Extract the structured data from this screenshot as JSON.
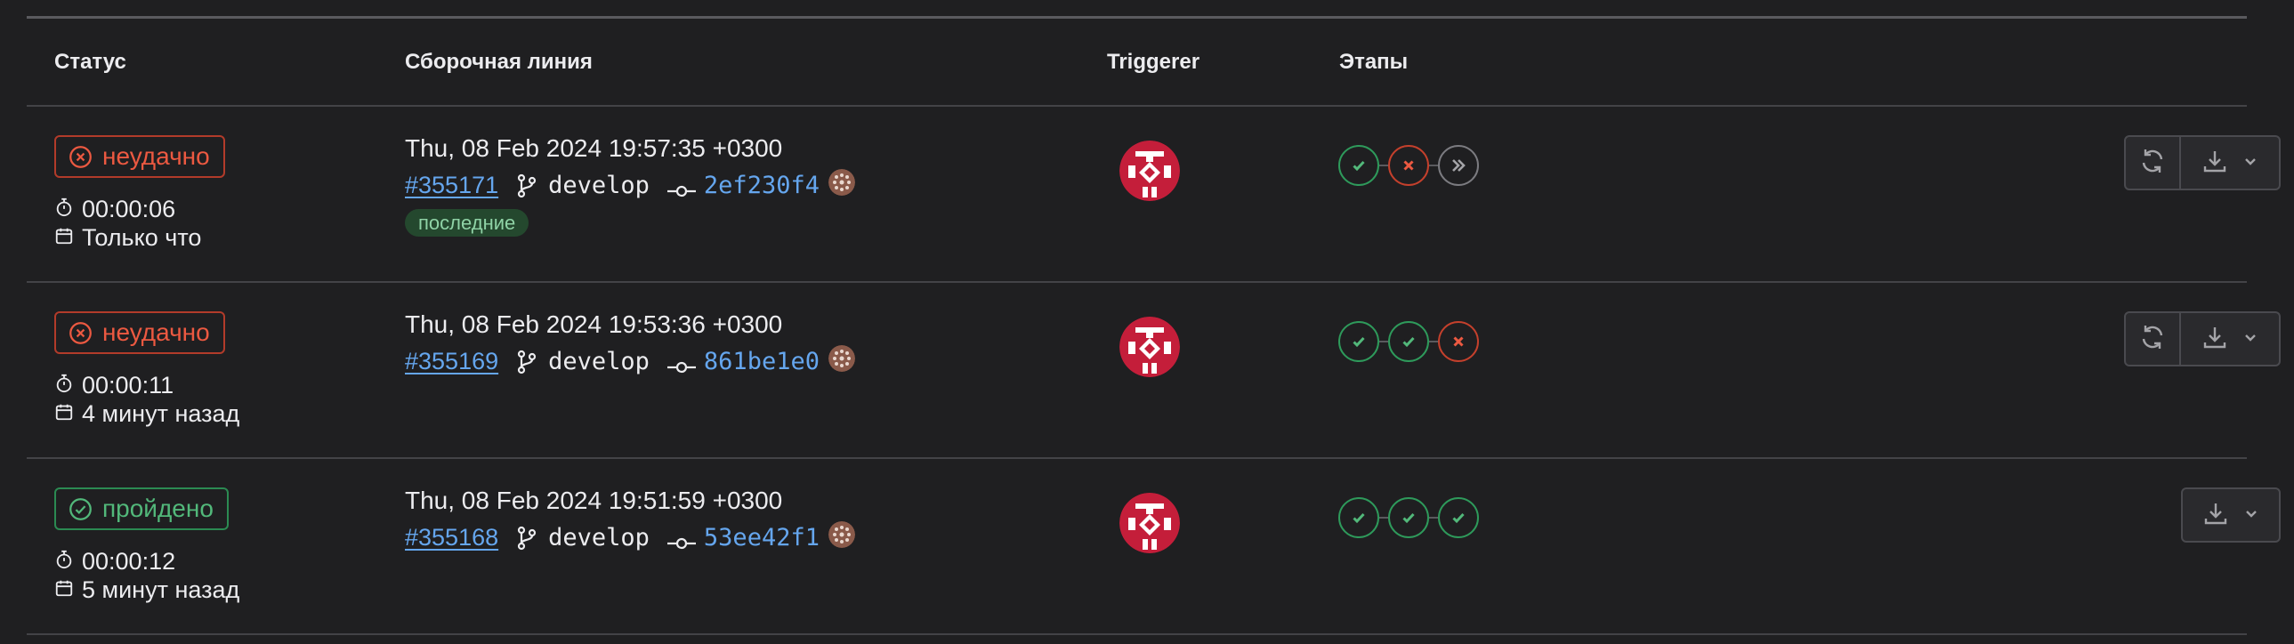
{
  "headers": {
    "status": "Статус",
    "pipeline": "Сборочная линия",
    "triggerer": "Triggerer",
    "stages": "Этапы"
  },
  "rows": [
    {
      "status": "неудачно",
      "status_kind": "failed",
      "duration": "00:00:06",
      "finished": "Только что",
      "date": "Thu, 08 Feb 2024 19:57:35 +0300",
      "id": "#355171",
      "branch": "develop",
      "sha": "2ef230f4",
      "tag": "последние",
      "stages": [
        "success",
        "failed",
        "skipped"
      ],
      "retry": true
    },
    {
      "status": "неудачно",
      "status_kind": "failed",
      "duration": "00:00:11",
      "finished": "4 минут назад",
      "date": "Thu, 08 Feb 2024 19:53:36 +0300",
      "id": "#355169",
      "branch": "develop",
      "sha": "861be1e0",
      "tag": null,
      "stages": [
        "success",
        "success",
        "failed"
      ],
      "retry": true
    },
    {
      "status": "пройдено",
      "status_kind": "passed",
      "duration": "00:00:12",
      "finished": "5 минут назад",
      "date": "Thu, 08 Feb 2024 19:51:59 +0300",
      "id": "#355168",
      "branch": "develop",
      "sha": "53ee42f1",
      "tag": null,
      "stages": [
        "success",
        "success",
        "success"
      ],
      "retry": false
    }
  ],
  "colors": {
    "failed": "#ec5941",
    "passed": "#52b87a",
    "link": "#65a6ee",
    "avatar_red": "#c41e3a"
  },
  "icons": {
    "status_failed": "x-circle-icon",
    "status_passed": "check-circle-icon",
    "duration": "timer-icon",
    "finished": "calendar-icon",
    "branch": "branch-icon",
    "commit": "commit-icon",
    "retry": "retry-icon",
    "download": "download-icon",
    "chevron": "chevron-down-icon"
  }
}
